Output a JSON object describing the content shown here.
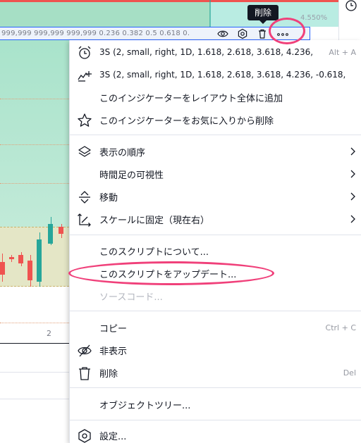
{
  "chart": {
    "pct_label": "4.550%",
    "fib_levels_text": "999,999 999,999 999,999 0.236 0.382 0.5 0.618 0.",
    "axis_label": "2",
    "tooltip": "削除"
  },
  "strip_icons": [
    "eye-icon",
    "gear-icon",
    "trash-icon",
    "more-horizontal-icon"
  ],
  "menu": {
    "items": [
      {
        "icon": "clock-alert-icon",
        "label": "3S (2, small, right, 1D, 1.618, 2.618, 3.618, 4.236,",
        "shortcut": "Alt + A"
      },
      {
        "icon": "chart-add-icon",
        "label": "3S (2, small, right, 1D, 1.618, 2.618, 3.618, 4.236, -0.618,"
      },
      {
        "icon": "",
        "label": "このインジケーターをレイアウト全体に追加"
      },
      {
        "icon": "star-icon",
        "label": "このインジケーターをお気に入りから削除"
      },
      {
        "icon": "layers-icon",
        "label": "表示の順序",
        "submenu": true
      },
      {
        "icon": "",
        "label": "時間足の可視性",
        "submenu": true
      },
      {
        "icon": "move-icon",
        "label": "移動",
        "submenu": true
      },
      {
        "icon": "pin-scale-icon",
        "label": "スケールに固定（現在右）",
        "submenu": true
      },
      {
        "icon": "",
        "label": "このスクリプトについて..."
      },
      {
        "icon": "",
        "label": "このスクリプトをアップデート..."
      },
      {
        "icon": "",
        "label": "ソースコード...",
        "disabled": true
      },
      {
        "icon": "",
        "label": "コピー",
        "shortcut": "Ctrl + C"
      },
      {
        "icon": "eye-off-icon",
        "label": "非表示"
      },
      {
        "icon": "trash-icon",
        "label": "削除",
        "shortcut": "Del"
      },
      {
        "icon": "",
        "label": "オブジェクトツリー..."
      },
      {
        "icon": "settings-hex-icon",
        "label": "設定..."
      }
    ]
  },
  "colors": {
    "highlight": "#f0407a",
    "accent_blue": "#2962ff",
    "bull": "#26a69a",
    "bear": "#ef5350"
  }
}
